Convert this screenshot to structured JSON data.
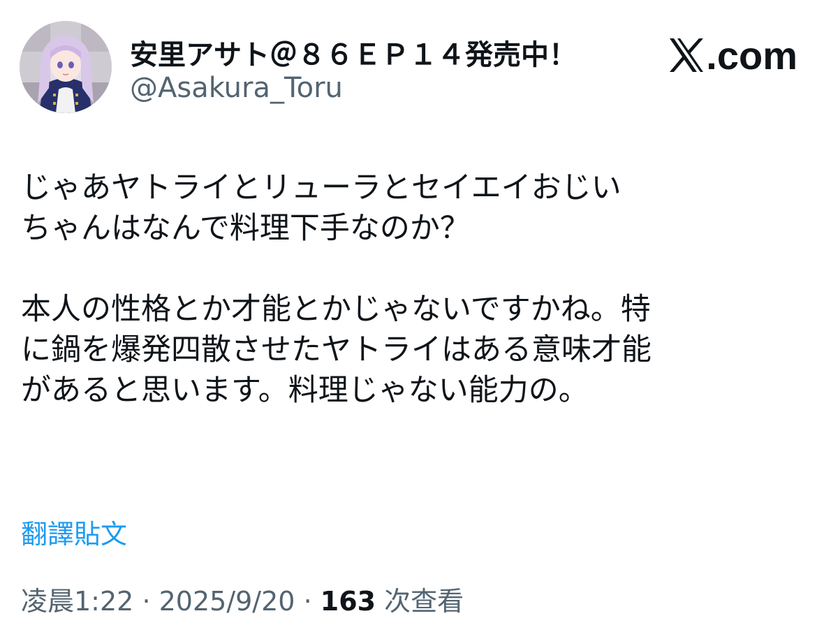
{
  "author": {
    "display_name": "安里アサト＠８６ＥＰ１４発売中！",
    "handle": "@Asakura_Toru"
  },
  "brand": {
    "label": ".com",
    "icon": "x-logo-icon"
  },
  "tweet": {
    "lines": [
      "じゃあヤトライとリューラとセイエイおじい",
      "ちゃんはなんで料理下手なのか？",
      "本人の性格とか才能とかじゃないですかね。特",
      "に鍋を爆発四散させたヤトライはある意味才能",
      "があると思います。料理じゃない能力の。"
    ]
  },
  "translate_label": "翻譯貼文",
  "meta": {
    "time": "凌晨1:22",
    "separator": "·",
    "date": "2025/9/20",
    "views_count": "163",
    "views_label": "次查看"
  },
  "colors": {
    "text": "#0f1419",
    "secondary": "#536471",
    "link": "#1d9bf0"
  }
}
